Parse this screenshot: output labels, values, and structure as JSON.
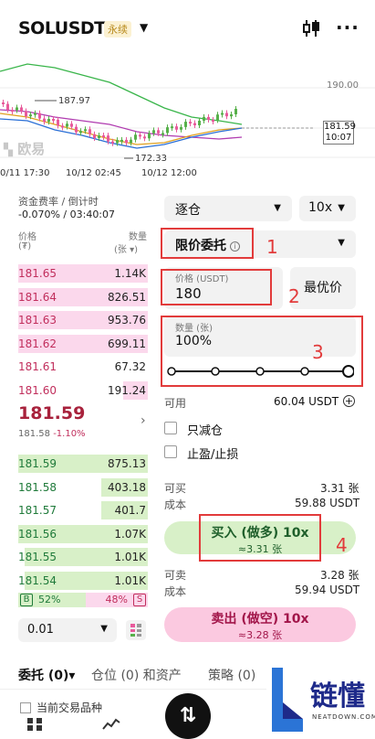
{
  "header": {
    "pair": "SOLUSDT",
    "contract_type": "永续"
  },
  "chart": {
    "price_high": "187.97",
    "price_low": "172.33",
    "axis_top": "190.00",
    "axis_mid": "180.00",
    "current_price": "181.59",
    "countdown": "10:07",
    "watermark": "欧易",
    "times": [
      "0/11 17:30",
      "10/12 02:45",
      "10/12 12:00"
    ]
  },
  "funding": {
    "label": "资金费率 / 倒计时",
    "value": "-0.070% / 03:40:07"
  },
  "book": {
    "price_header": "价格",
    "price_unit": "(₮)",
    "qty_header": "数量",
    "qty_unit": "(张 ▾)",
    "asks": [
      {
        "price": "181.65",
        "qty": "1.14K",
        "depth": 1.0
      },
      {
        "price": "181.64",
        "qty": "826.51",
        "depth": 1.0
      },
      {
        "price": "181.63",
        "qty": "953.76",
        "depth": 1.0
      },
      {
        "price": "181.62",
        "qty": "699.11",
        "depth": 1.0
      },
      {
        "price": "181.61",
        "qty": "67.32",
        "depth": 0.0
      },
      {
        "price": "181.60",
        "qty": "191.24",
        "depth": 0.19
      }
    ],
    "last_price": "181.59",
    "last_mark": "181.58",
    "last_change": "-1.10%",
    "bids": [
      {
        "price": "181.59",
        "qty": "875.13",
        "depth": 1.0
      },
      {
        "price": "181.58",
        "qty": "403.18",
        "depth": 0.36
      },
      {
        "price": "181.57",
        "qty": "401.7",
        "depth": 0.36
      },
      {
        "price": "181.56",
        "qty": "1.07K",
        "depth": 1.0
      },
      {
        "price": "181.55",
        "qty": "1.01K",
        "depth": 0.95
      },
      {
        "price": "181.54",
        "qty": "1.01K",
        "depth": 0.95
      }
    ],
    "buy_ratio": "52%",
    "sell_ratio": "48%",
    "buy_ratio_value": 0.52,
    "b_label": "B",
    "s_label": "S",
    "depth_step": "0.01"
  },
  "form": {
    "margin_mode": "逐仓",
    "leverage": "10x",
    "order_type": "限价委托",
    "price_label": "价格 (USDT)",
    "price_value": "180",
    "best_price": "最优价",
    "qty_label": "数量 (张)",
    "qty_value": "100%",
    "slider_level": 1.0,
    "available_label": "可用",
    "available_value": "60.04 USDT",
    "reduce_only": "只减仓",
    "tp_sl": "止盈/止损",
    "can_buy_label": "可买",
    "can_buy_value": "3.31 张",
    "cost_label": "成本",
    "cost_buy_value": "59.88 USDT",
    "buy_button": "买入 (做多) 10x",
    "buy_sub": "≈3.31 张",
    "can_sell_label": "可卖",
    "can_sell_value": "3.28 张",
    "cost_sell_value": "59.94 USDT",
    "sell_button": "卖出 (做空) 10x",
    "sell_sub": "≈3.28 张"
  },
  "annotations": [
    "1",
    "2",
    "3",
    "4"
  ],
  "tabs": [
    "委托 (0)▾",
    "仓位 (0) 和资产",
    "策略 (0)"
  ],
  "bottom": {
    "partial_text": "当前交易品种",
    "fab": "⇅"
  },
  "watermark": {
    "text": "链懂",
    "sub": "NEATDOWN.COM"
  },
  "colors": {
    "ask": "#c12e5c",
    "bid": "#1f7a3a",
    "annotation": "#e23b3b"
  }
}
